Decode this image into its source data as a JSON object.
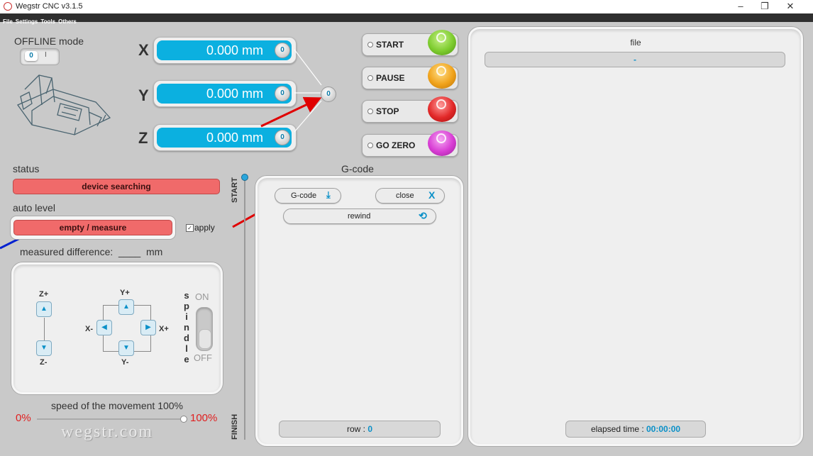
{
  "window": {
    "title": "Wegstr CNC  v3.1.5",
    "min": "–",
    "max": "❐",
    "close": "✕"
  },
  "menu": [
    "File",
    "Settings",
    "Tools",
    "Others"
  ],
  "offline": {
    "label": "OFFLINE mode",
    "toggle_on": "0",
    "toggle_off": "I"
  },
  "axes": [
    {
      "name": "X",
      "value": "0.000 mm",
      "zero": "0"
    },
    {
      "name": "Y",
      "value": "0.000 mm",
      "zero": "0"
    },
    {
      "name": "Z",
      "value": "0.000 mm",
      "zero": "0"
    }
  ],
  "all_zero": "0",
  "controls": {
    "start": "START",
    "pause": "PAUSE",
    "stop": "STOP",
    "go_zero": "GO ZERO",
    "colors": {
      "start": "#7dcc2e",
      "pause": "#f0a21a",
      "stop": "#e22828",
      "go_zero": "#d83cd4"
    }
  },
  "status": {
    "label": "status",
    "value": "device searching"
  },
  "autolevel": {
    "label": "auto level",
    "button": "empty / measure",
    "apply": "apply",
    "apply_checked": true
  },
  "measured": "measured difference:  ____  mm",
  "jog": {
    "zplus": "Z+",
    "zminus": "Z-",
    "yplus": "Y+",
    "yminus": "Y-",
    "xminus": "X-",
    "xplus": "X+",
    "spindle_letters": [
      "s",
      "p",
      "i",
      "n",
      "d",
      "l",
      "e"
    ],
    "spindle_on": "ON",
    "spindle_off": "OFF"
  },
  "speed": {
    "label": "speed of the movement 100%",
    "min": "0%",
    "max": "100%",
    "value_percent": 100
  },
  "brand": "wegstr.com",
  "progress": {
    "start": "START",
    "finish": "FINISH"
  },
  "gcode": {
    "title": "G-code",
    "load": "G-code",
    "close": "close",
    "rewind": "rewind",
    "row_label": "row : ",
    "row_value": "0"
  },
  "file": {
    "title": "file",
    "name": "-",
    "elapsed_label": "elapsed time : ",
    "elapsed_value": "00:00:00"
  },
  "accent": "#0bb0e0",
  "status_color": "#f06a6a"
}
